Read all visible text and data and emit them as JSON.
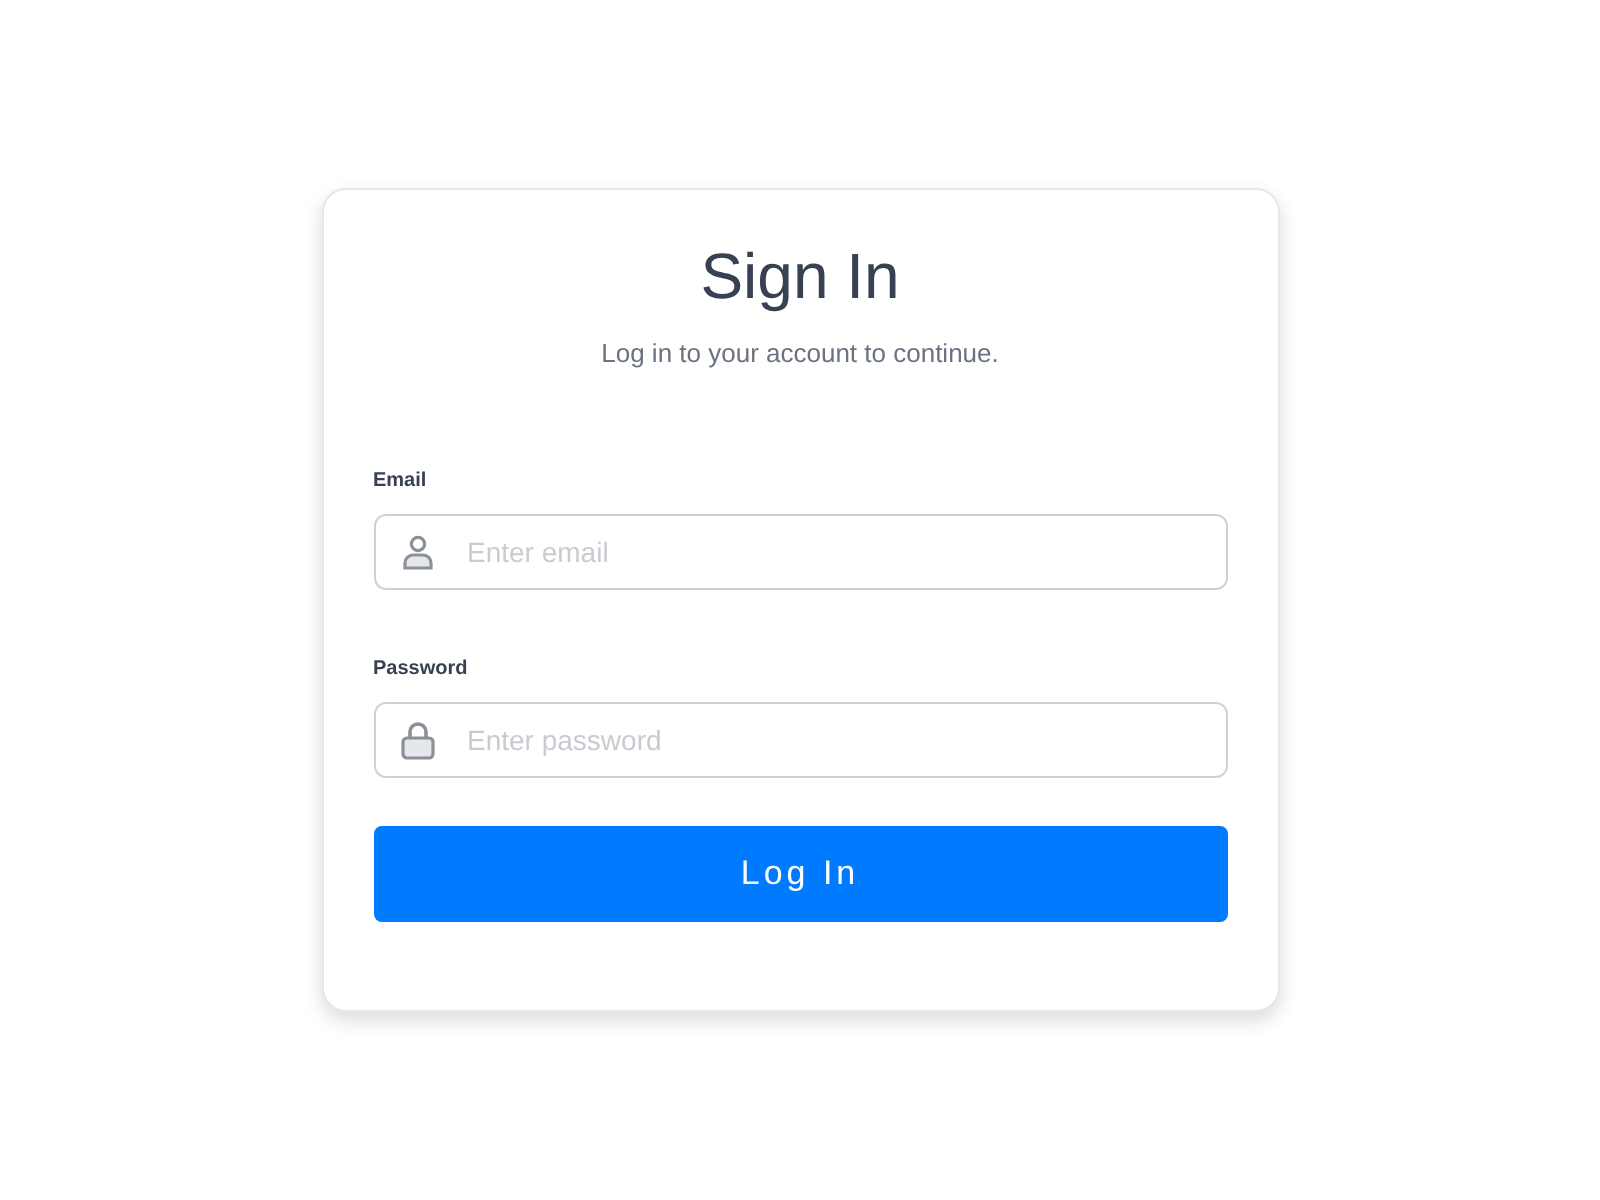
{
  "card": {
    "title": "Sign In",
    "subtitle": "Log in to your account to continue."
  },
  "fields": [
    {
      "label": "Email",
      "kind": "user",
      "placeholder": "Enter email"
    },
    {
      "label": "Password",
      "kind": "lock",
      "placeholder": "Enter password"
    }
  ],
  "submit_button": "Log In"
}
